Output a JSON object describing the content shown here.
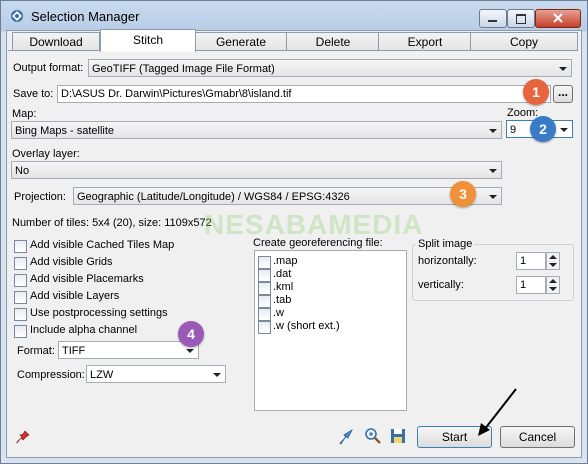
{
  "window": {
    "title": "Selection Manager"
  },
  "tabs": [
    {
      "label": "Download"
    },
    {
      "label": "Stitch"
    },
    {
      "label": "Generate"
    },
    {
      "label": "Delete"
    },
    {
      "label": "Export"
    },
    {
      "label": "Copy"
    }
  ],
  "output_format": {
    "label": "Output format:",
    "value": "GeoTIFF (Tagged Image File Format)"
  },
  "save_to": {
    "label": "Save to:",
    "value": "D:\\ASUS Dr. Darwin\\Pictures\\Gmabr\\8\\island.tif",
    "browse_label": "..."
  },
  "map": {
    "label": "Map:",
    "value": "Bing Maps - satellite"
  },
  "zoom": {
    "label": "Zoom:",
    "value": "9"
  },
  "overlay": {
    "label": "Overlay layer:",
    "value": "No"
  },
  "projection": {
    "label": "Projection:",
    "value": "Geographic (Latitude/Longitude) / WGS84 / EPSG:4326"
  },
  "tiles_info": "Number of tiles: 5x4 (20), size: 1109x572",
  "watermark": "NESABAMEDIA",
  "checkboxes": [
    {
      "label": "Add visible Cached Tiles Map"
    },
    {
      "label": "Add visible Grids"
    },
    {
      "label": "Add visible Placemarks"
    },
    {
      "label": "Add visible Layers"
    },
    {
      "label": "Use postprocessing settings"
    },
    {
      "label": "Include alpha channel"
    }
  ],
  "format": {
    "label": "Format:",
    "value": "TIFF"
  },
  "compression": {
    "label": "Compression:",
    "value": "LZW"
  },
  "georef": {
    "title": "Create georeferencing file:",
    "items": [
      ".map",
      ".dat",
      ".kml",
      ".tab",
      ".w",
      ".w (short ext.)"
    ]
  },
  "split": {
    "title": "Split image",
    "horizontal_label": "horizontally:",
    "horizontal_value": "1",
    "vertical_label": "vertically:",
    "vertical_value": "1"
  },
  "buttons": {
    "start": "Start",
    "cancel": "Cancel"
  },
  "badges": [
    "1",
    "2",
    "3",
    "4"
  ],
  "colors": {
    "badge_red": "#e8643c",
    "badge_blue": "#3a7bc8",
    "badge_orange": "#f0913a",
    "badge_purple": "#9b59b6"
  }
}
